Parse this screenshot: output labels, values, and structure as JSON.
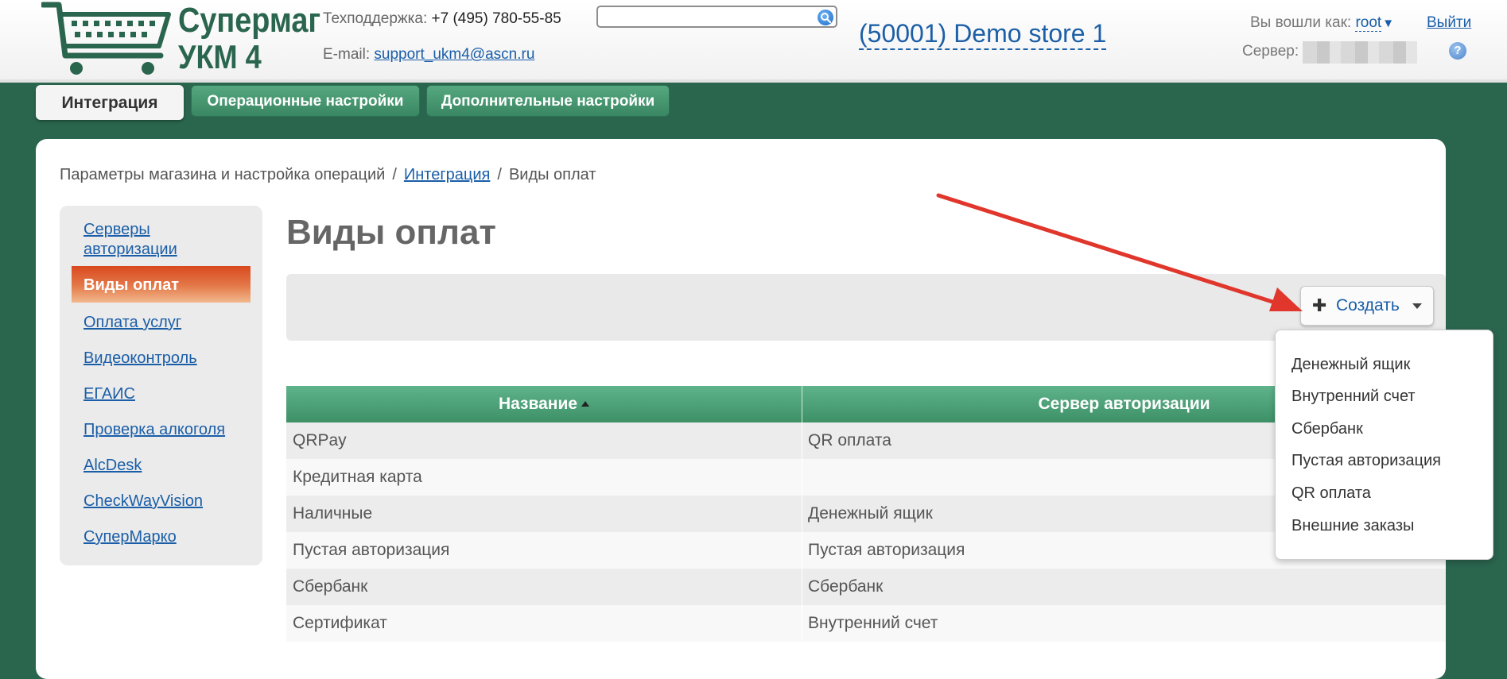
{
  "header": {
    "logo": {
      "line1": "Супермаг",
      "line2": "УКМ 4",
      "color": "#2a654e"
    },
    "support_label": "Техподдержка:",
    "support_phone": "+7 (495) 780-55-85",
    "email_label": "E-mail:",
    "email": "support_ukm4@ascn.ru",
    "search": {
      "value": "",
      "icon": "search-icon"
    },
    "store": "(50001) Demo store 1",
    "logged_in_label": "Вы вошли как:",
    "user": "root",
    "logout": "Выйти",
    "server_label": "Сервер:",
    "help_glyph": "?"
  },
  "tabs": [
    {
      "label": "Интеграция",
      "active": true
    },
    {
      "label": "Операционные настройки",
      "active": false
    },
    {
      "label": "Дополнительные настройки",
      "active": false
    }
  ],
  "breadcrumb": {
    "item1": "Параметры магазина и настройка операций",
    "sep": "/",
    "item2": "Интеграция",
    "item3": "Виды оплат"
  },
  "sidebar": {
    "items": [
      {
        "label": "Серверы авторизации",
        "active": false
      },
      {
        "label": "Виды оплат",
        "active": true
      },
      {
        "label": "Оплата услуг",
        "active": false
      },
      {
        "label": "Видеоконтроль",
        "active": false
      },
      {
        "label": "ЕГАИС",
        "active": false
      },
      {
        "label": "Проверка алкоголя",
        "active": false
      },
      {
        "label": "AlcDesk",
        "active": false
      },
      {
        "label": "CheckWayVision",
        "active": false
      },
      {
        "label": "СуперМарко",
        "active": false
      }
    ]
  },
  "page_title": "Виды оплат",
  "toolbar": {
    "create_label": "Создать",
    "plus_glyph": "✚"
  },
  "table": {
    "columns": [
      "Название",
      "Сервер авторизации"
    ],
    "sort": {
      "column": "Название",
      "direction": "asc"
    },
    "rows": [
      [
        "QRPay",
        "QR оплата"
      ],
      [
        "Кредитная карта",
        ""
      ],
      [
        "Наличные",
        "Денежный ящик"
      ],
      [
        "Пустая авторизация",
        "Пустая авторизация"
      ],
      [
        "Сбербанк",
        "Сбербанк"
      ],
      [
        "Сертификат",
        "Внутренний счет"
      ]
    ]
  },
  "create_menu": {
    "items": [
      "Денежный ящик",
      "Внутренний счет",
      "Сбербанк",
      "Пустая авторизация",
      "QR оплата",
      "Внешние заказы"
    ]
  },
  "colors": {
    "brand_green": "#2a654e",
    "table_header": "#4fa37b",
    "active_sidebar": "#d9481f",
    "link": "#1a5ea8",
    "annotation_arrow": "#e0362b"
  }
}
